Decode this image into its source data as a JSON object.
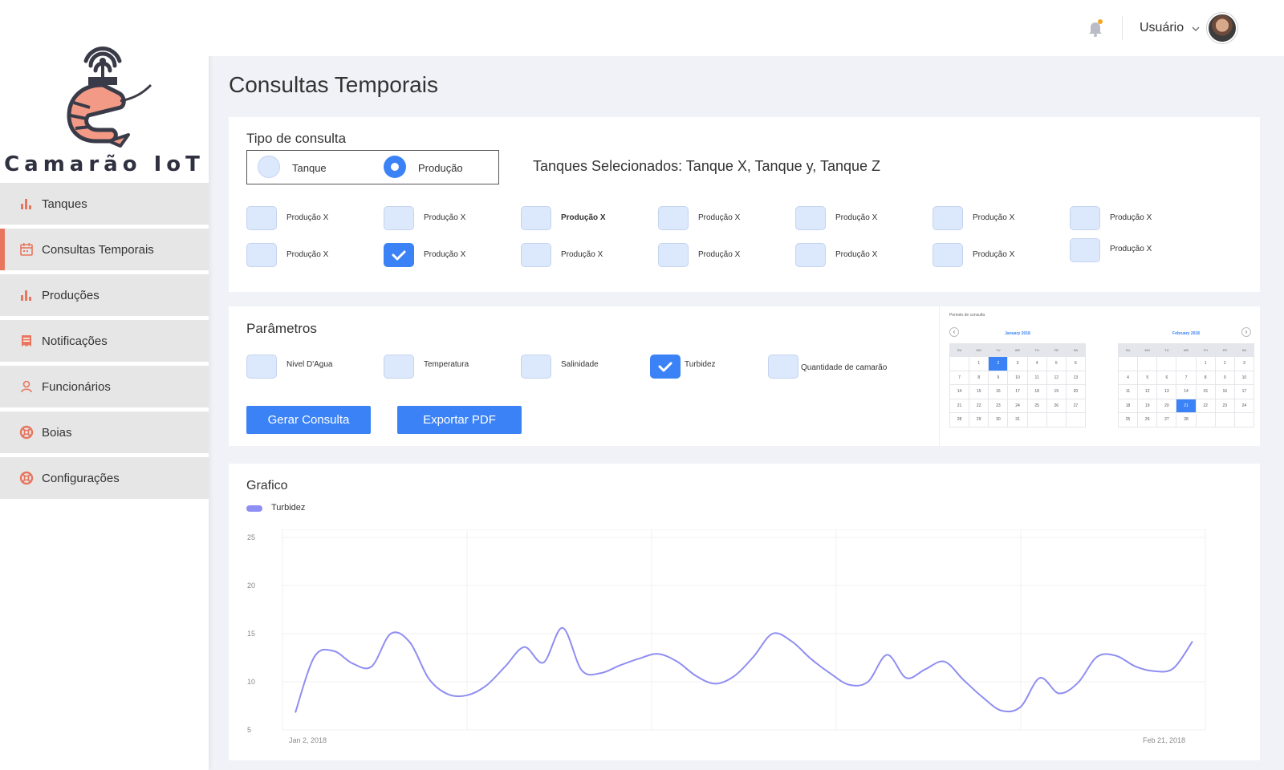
{
  "brand": {
    "name": "Camarão IoT"
  },
  "sidebar": {
    "items": [
      {
        "label": "Tanques",
        "icon": "bar-chart-icon",
        "active": false
      },
      {
        "label": "Consultas Temporais",
        "icon": "calendar-icon",
        "active": true
      },
      {
        "label": "Produções",
        "icon": "bar-chart-icon",
        "active": false
      },
      {
        "label": "Notificações",
        "icon": "receipt-icon",
        "active": false
      },
      {
        "label": "Funcionários",
        "icon": "person-icon",
        "active": false
      },
      {
        "label": "Boias",
        "icon": "lifebuoy-icon",
        "active": false
      },
      {
        "label": "Configurações",
        "icon": "lifebuoy-icon",
        "active": false
      }
    ]
  },
  "header": {
    "user_label": "Usuário"
  },
  "page": {
    "title": "Consultas Temporais"
  },
  "tipo": {
    "title": "Tipo de consulta",
    "options": [
      {
        "label": "Tanque",
        "checked": false
      },
      {
        "label": "Produção",
        "checked": true
      }
    ],
    "tanques_selecionados": "Tanques Selecionados: Tanque X, Tanque y, Tanque Z"
  },
  "producoes": {
    "row1": [
      {
        "label": "Produção X",
        "checked": false
      },
      {
        "label": "Produção X",
        "checked": false
      },
      {
        "label": "Produção X",
        "checked": false,
        "bold": true
      },
      {
        "label": "Produção X",
        "checked": false
      },
      {
        "label": "Produção X",
        "checked": false
      },
      {
        "label": "Produção X",
        "checked": false
      },
      {
        "label": "Produção X",
        "checked": false
      }
    ],
    "row2": [
      {
        "label": "Produção X",
        "checked": false
      },
      {
        "label": "Produção X",
        "checked": true
      },
      {
        "label": "Produção X",
        "checked": false
      },
      {
        "label": "Produção X",
        "checked": false
      },
      {
        "label": "Produção X",
        "checked": false
      },
      {
        "label": "Produção X",
        "checked": false
      },
      {
        "label": "Produção X",
        "checked": false
      }
    ]
  },
  "parametros": {
    "title": "Parâmetros",
    "items": [
      {
        "label": "Nivel D'Agua",
        "checked": false
      },
      {
        "label": "Temperatura",
        "checked": false
      },
      {
        "label": "Salinidade",
        "checked": false
      },
      {
        "label": "Turbidez",
        "checked": true
      },
      {
        "label": "Quantidade de camarão",
        "checked": false
      }
    ],
    "btn_gerar": "Gerar Consulta",
    "btn_exportar": "Exportar PDF"
  },
  "calendar": {
    "title": "Periodo de consulta",
    "weekdays": [
      "SU",
      "MO",
      "TU",
      "WE",
      "TH",
      "FR",
      "SA"
    ],
    "months": [
      {
        "name": "January 2018",
        "weeks": [
          [
            "",
            "1",
            "2",
            "3",
            "4",
            "5",
            "6"
          ],
          [
            "7",
            "8",
            "9",
            "10",
            "11",
            "12",
            "13"
          ],
          [
            "14",
            "15",
            "16",
            "17",
            "18",
            "19",
            "20"
          ],
          [
            "21",
            "22",
            "23",
            "24",
            "25",
            "26",
            "27"
          ],
          [
            "28",
            "29",
            "30",
            "31",
            "",
            "",
            ""
          ]
        ],
        "selected": "2"
      },
      {
        "name": "February 2018",
        "weeks": [
          [
            "",
            "",
            "",
            "",
            "1",
            "2",
            "3"
          ],
          [
            "4",
            "5",
            "6",
            "7",
            "8",
            "9",
            "10"
          ],
          [
            "11",
            "12",
            "13",
            "14",
            "15",
            "16",
            "17"
          ],
          [
            "18",
            "19",
            "20",
            "21",
            "22",
            "23",
            "24"
          ],
          [
            "25",
            "26",
            "27",
            "28",
            "",
            "",
            ""
          ]
        ],
        "selected": "21"
      }
    ]
  },
  "grafico": {
    "title": "Grafico",
    "legend": "Turbidez",
    "color": "#8f8ef2"
  },
  "chart_data": {
    "type": "line",
    "series": [
      {
        "name": "Turbidez",
        "values": [
          6.8,
          12.6,
          13.2,
          11.9,
          11.6,
          15.0,
          14.1,
          10.3,
          8.7,
          8.6,
          9.6,
          11.6,
          13.6,
          12.0,
          15.6,
          11.2,
          10.9,
          11.7,
          12.4,
          12.9,
          12.1,
          10.6,
          9.8,
          10.6,
          12.6,
          15.0,
          14.2,
          12.4,
          10.9,
          9.7,
          10.0,
          12.8,
          10.4,
          11.3,
          12.1,
          10.2,
          8.4,
          7.0,
          7.4,
          10.4,
          8.8,
          9.9,
          12.6,
          12.7,
          11.6,
          11.1,
          11.4,
          14.2
        ]
      }
    ],
    "x_labels": [
      "Jan 2, 2018",
      "Feb 21, 2018"
    ],
    "y_ticks": [
      5,
      10,
      15,
      20,
      25
    ],
    "ylim": [
      5,
      25
    ],
    "grid": true,
    "legend_position": "top-left"
  }
}
